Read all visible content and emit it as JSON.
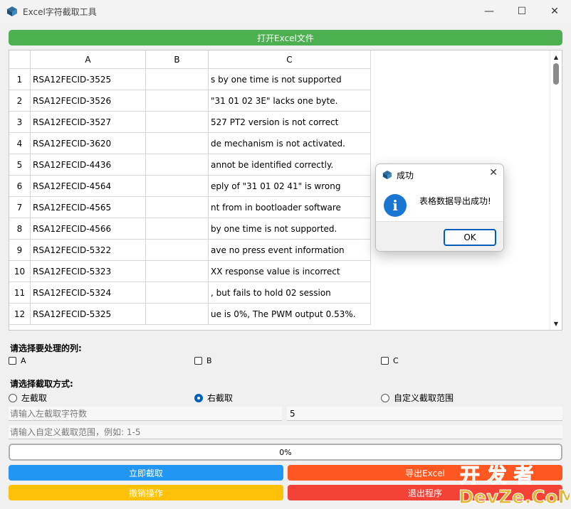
{
  "window": {
    "title": "Excel字符截取工具",
    "minimize": "—",
    "maximize": "☐",
    "close": "✕"
  },
  "toolbar": {
    "open_label": "打开Excel文件"
  },
  "table": {
    "columns": [
      "A",
      "B",
      "C"
    ],
    "rows": [
      {
        "n": "1",
        "a": "RSA12FECID-3525",
        "b": "",
        "c": "s by one time is not supported"
      },
      {
        "n": "2",
        "a": "RSA12FECID-3526",
        "b": "",
        "c": " \"31 01 02 3E\" lacks one byte."
      },
      {
        "n": "3",
        "a": "RSA12FECID-3527",
        "b": "",
        "c": "527 PT2 version is not correct"
      },
      {
        "n": "4",
        "a": "RSA12FECID-3620",
        "b": "",
        "c": "de mechanism is not activated."
      },
      {
        "n": "5",
        "a": "RSA12FECID-4436",
        "b": "",
        "c": "annot be identified correctly."
      },
      {
        "n": "6",
        "a": "RSA12FECID-4564",
        "b": "",
        "c": "eply of \"31 01 02 41\" is wrong"
      },
      {
        "n": "7",
        "a": "RSA12FECID-4565",
        "b": "",
        "c": "nt from in bootloader software"
      },
      {
        "n": "8",
        "a": "RSA12FECID-4566",
        "b": "",
        "c": " by one time is not supported."
      },
      {
        "n": "9",
        "a": "RSA12FECID-5322",
        "b": "",
        "c": "ave no press event information"
      },
      {
        "n": "10",
        "a": "RSA12FECID-5323",
        "b": "",
        "c": "XX response value is incorrect"
      },
      {
        "n": "11",
        "a": "RSA12FECID-5324",
        "b": "",
        "c": ", but fails to hold 02 session"
      },
      {
        "n": "12",
        "a": "RSA12FECID-5325",
        "b": "",
        "c": "ue is 0%, The PWM output 0.53%."
      }
    ]
  },
  "columns_section": {
    "label": "请选择要处理的列:",
    "options": [
      "A",
      "B",
      "C"
    ]
  },
  "mode_section": {
    "label": "请选择截取方式:",
    "options": [
      "左截取",
      "右截取",
      "自定义截取范围"
    ],
    "selected": "右截取"
  },
  "inputs": {
    "left_count_placeholder": "请输入左截取字符数",
    "right_count_value": "5",
    "range_placeholder": "请输入自定义截取范围，例如: 1-5"
  },
  "progress": {
    "text": "0%",
    "value": 0
  },
  "actions": {
    "cut": "立即截取",
    "export": "导出Excel",
    "undo": "撤销操作",
    "exit": "退出程序"
  },
  "watermark": {
    "line1": "开 发 者",
    "line2": "DevZe.CoM"
  },
  "dialog": {
    "title": "成功",
    "message": "表格数据导出成功!",
    "ok": "OK",
    "close": "✕"
  },
  "colors": {
    "green": "#4caf50",
    "blue": "#2196f3",
    "orange": "#ff5722",
    "amber": "#ffc107",
    "red": "#f44336",
    "info": "#1976d2"
  }
}
